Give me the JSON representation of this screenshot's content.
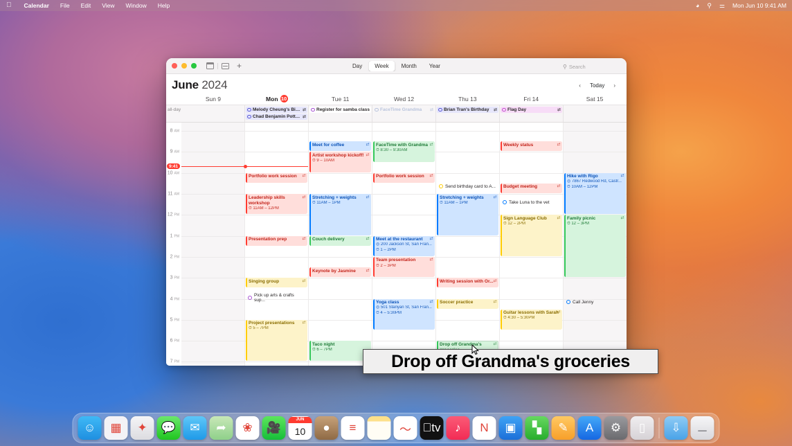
{
  "menubar": {
    "apple_icon": "apple-logo-icon",
    "items": [
      "Calendar",
      "File",
      "Edit",
      "View",
      "Window",
      "Help"
    ],
    "status_icons": [
      "wifi-icon",
      "search-icon",
      "control-center-icon"
    ],
    "clock": "Mon Jun 10  9:41 AM"
  },
  "window": {
    "toolbar": {
      "calendar_view_icon": "calendar-icon",
      "inbox_icon": "inbox-icon",
      "add_label": "+",
      "segments": [
        "Day",
        "Week",
        "Month",
        "Year"
      ],
      "active_segment": "Week",
      "search_placeholder": "Search",
      "search_icon": "magnifier-icon"
    },
    "header": {
      "month": "June",
      "year": "2024",
      "prev_label": "‹",
      "today_label": "Today",
      "next_label": "›"
    },
    "days": [
      {
        "label": "Sun 9",
        "weekday": "Sun",
        "num": "9",
        "today": false,
        "weekend": true
      },
      {
        "label": "Mon 10",
        "weekday": "Mon",
        "num": "10",
        "today": true,
        "weekend": false
      },
      {
        "label": "Tue 11",
        "weekday": "Tue",
        "num": "11",
        "today": false,
        "weekend": false
      },
      {
        "label": "Wed 12",
        "weekday": "Wed",
        "num": "12",
        "today": false,
        "weekend": false
      },
      {
        "label": "Thu 13",
        "weekday": "Thu",
        "num": "13",
        "today": false,
        "weekend": false
      },
      {
        "label": "Fri 14",
        "weekday": "Fri",
        "num": "14",
        "today": false,
        "weekend": false
      },
      {
        "label": "Sat 15",
        "weekday": "Sat",
        "num": "15",
        "today": false,
        "weekend": true
      }
    ],
    "allday_label": "all-day",
    "allday_events": [
      {
        "day": 1,
        "title": "Melody Cheung's Birt...",
        "color": "#5a5ad6",
        "bg": "#e6e6fb",
        "repeat": true
      },
      {
        "day": 1,
        "title": "Chad Benjamin Potter...",
        "color": "#5a5ad6",
        "bg": "#e6e6fb",
        "repeat": true
      },
      {
        "day": 2,
        "title": "Register for samba class",
        "color": "#a74fd3",
        "bg": "#ffffff",
        "repeat": false
      },
      {
        "day": 3,
        "title": "FaceTime Grandma",
        "color": "#b9c4dd",
        "bg": "#f7f5f6",
        "repeat": true,
        "dim": true
      },
      {
        "day": 4,
        "title": "Brian Tran's Birthday",
        "color": "#5a5ad6",
        "bg": "#e6e6fb",
        "repeat": true
      },
      {
        "day": 5,
        "title": "Flag Day",
        "color": "#c44fd0",
        "bg": "#f7dcf7",
        "repeat": true
      }
    ],
    "time_labels": [
      {
        "hour": "8",
        "suffix": "AM"
      },
      {
        "hour": "9",
        "suffix": "AM"
      },
      {
        "hour": "10",
        "suffix": "AM"
      },
      {
        "hour": "11",
        "suffix": "AM"
      },
      {
        "hour": "12",
        "suffix": "PM"
      },
      {
        "hour": "1",
        "suffix": "PM"
      },
      {
        "hour": "2",
        "suffix": "PM"
      },
      {
        "hour": "3",
        "suffix": "PM"
      },
      {
        "hour": "4",
        "suffix": "PM"
      },
      {
        "hour": "5",
        "suffix": "PM"
      },
      {
        "hour": "6",
        "suffix": "PM"
      },
      {
        "hour": "7",
        "suffix": "PM"
      }
    ],
    "now": {
      "badge": "9:41",
      "hour_position": 9.68
    },
    "events": [
      {
        "day": 1,
        "title": "Portfolio work session",
        "start": 10.0,
        "end": 10.5,
        "color": "#ff3b30",
        "bg": "#ffdedb",
        "text": "#c32219",
        "repeat": true
      },
      {
        "day": 1,
        "title": "Leadership skills workshop",
        "time": "11AM – 12PM",
        "start": 11.0,
        "end": 12.0,
        "color": "#ff3b30",
        "bg": "#ffdedb",
        "text": "#c32219",
        "repeat": true,
        "two_line": true,
        "clock": true
      },
      {
        "day": 1,
        "title": "Presentation prep",
        "start": 13.0,
        "end": 13.5,
        "color": "#ff3b30",
        "bg": "#ffdedb",
        "text": "#c32219",
        "repeat": true
      },
      {
        "day": 1,
        "title": "Singing group",
        "start": 15.0,
        "end": 15.5,
        "color": "#ffcc00",
        "bg": "#fdf3c9",
        "text": "#8a6d00",
        "repeat": true
      },
      {
        "day": 1,
        "title": "Project presentations",
        "time": "5 – 7PM",
        "start": 17.0,
        "end": 19.0,
        "color": "#ffcc00",
        "bg": "#fdf3c9",
        "text": "#8a6d00",
        "repeat": true,
        "clock": true
      },
      {
        "day": 2,
        "title": "Meet for coffee",
        "start": 8.5,
        "end": 9.0,
        "color": "#007aff",
        "bg": "#cfe4ff",
        "text": "#0a52b8",
        "repeat": true
      },
      {
        "day": 2,
        "title": "Artist workshop kickoff!",
        "time": "9 – 10AM",
        "start": 9.0,
        "end": 10.0,
        "color": "#ff3b30",
        "bg": "#ffdedb",
        "text": "#c32219",
        "repeat": true,
        "clock": true
      },
      {
        "day": 2,
        "title": "Stretching + weights",
        "time": "11AM – 1PM",
        "start": 11.0,
        "end": 13.0,
        "color": "#007aff",
        "bg": "#cfe4ff",
        "text": "#0a52b8",
        "repeat": true,
        "clock": true
      },
      {
        "day": 2,
        "title": "Couch delivery",
        "start": 13.0,
        "end": 13.5,
        "color": "#34c759",
        "bg": "#d6f4dd",
        "text": "#1d7a36",
        "repeat": true
      },
      {
        "day": 2,
        "title": "Keynote by Jasmine",
        "start": 14.5,
        "end": 15.0,
        "color": "#ff3b30",
        "bg": "#ffdedb",
        "text": "#c32219",
        "repeat": true
      },
      {
        "day": 2,
        "title": "Taco night",
        "time": "6 – 7PM",
        "start": 18.0,
        "end": 19.0,
        "color": "#34c759",
        "bg": "#d6f4dd",
        "text": "#1d7a36",
        "repeat": false,
        "clock": true
      },
      {
        "day": 3,
        "title": "FaceTime with Grandma",
        "time": "8:30 – 9:30AM",
        "start": 8.5,
        "end": 9.5,
        "color": "#34c759",
        "bg": "#d6f4dd",
        "text": "#1d7a36",
        "repeat": true,
        "clock": true
      },
      {
        "day": 3,
        "title": "Portfolio work session",
        "start": 10.0,
        "end": 10.5,
        "color": "#ff3b30",
        "bg": "#ffdedb",
        "text": "#c32219",
        "repeat": true
      },
      {
        "day": 3,
        "title": "Meet at the restaurant",
        "place": "200 Jackson St, San Fran...",
        "time": "1 – 2PM",
        "start": 13.0,
        "end": 14.0,
        "color": "#007aff",
        "bg": "#cfe4ff",
        "text": "#0a52b8",
        "repeat": true,
        "clock": true,
        "pin": true
      },
      {
        "day": 3,
        "title": "Team presentation",
        "time": "2 – 3PM",
        "start": 14.0,
        "end": 15.0,
        "color": "#ff3b30",
        "bg": "#ffdedb",
        "text": "#c32219",
        "repeat": true,
        "clock": true
      },
      {
        "day": 3,
        "title": "Yoga class",
        "place": "501 Stanyan St, San Fran...",
        "time": "4 – 5:30PM",
        "start": 16.0,
        "end": 17.5,
        "color": "#007aff",
        "bg": "#cfe4ff",
        "text": "#0a52b8",
        "repeat": true,
        "clock": true,
        "pin": true
      },
      {
        "day": 4,
        "title": "Stretching + weights",
        "time": "11AM – 1PM",
        "start": 11.0,
        "end": 13.0,
        "color": "#007aff",
        "bg": "#cfe4ff",
        "text": "#0a52b8",
        "repeat": true,
        "clock": true
      },
      {
        "day": 4,
        "title": "Writing session with Or...",
        "start": 15.0,
        "end": 15.5,
        "color": "#ff3b30",
        "bg": "#ffdedb",
        "text": "#c32219",
        "repeat": true
      },
      {
        "day": 4,
        "title": "Soccer practice",
        "start": 16.0,
        "end": 16.5,
        "color": "#ffcc00",
        "bg": "#fdf3c9",
        "text": "#8a6d00",
        "repeat": true
      },
      {
        "day": 4,
        "title": "Drop off Grandma's groceries",
        "start": 18.0,
        "end": 19.0,
        "color": "#34c759",
        "bg": "#d6f4dd",
        "text": "#1d7a36",
        "repeat": true,
        "two_line": true,
        "hovered": true
      },
      {
        "day": 5,
        "title": "Weekly status",
        "start": 8.5,
        "end": 9.0,
        "color": "#ff3b30",
        "bg": "#ffdedb",
        "text": "#c32219",
        "repeat": true
      },
      {
        "day": 5,
        "title": "Budget meeting",
        "start": 10.5,
        "end": 11.0,
        "color": "#ff3b30",
        "bg": "#ffdedb",
        "text": "#c32219",
        "repeat": true
      },
      {
        "day": 5,
        "title": "Sign Language Club",
        "time": "12 – 2PM",
        "start": 12.0,
        "end": 14.0,
        "color": "#ffcc00",
        "bg": "#fdf3c9",
        "text": "#8a6d00",
        "repeat": true,
        "clock": true
      },
      {
        "day": 5,
        "title": "Guitar lessons with Sarah",
        "time": "4:30 – 5:30PM",
        "start": 16.5,
        "end": 17.5,
        "color": "#ffcc00",
        "bg": "#fdf3c9",
        "text": "#8a6d00",
        "repeat": true,
        "two_line": true,
        "clock": true
      },
      {
        "day": 6,
        "title": "Hike with Rigo",
        "place": "7867 Redwood Rd, Castr...",
        "time": "10AM – 12PM",
        "start": 10.0,
        "end": 12.0,
        "color": "#007aff",
        "bg": "#cfe4ff",
        "text": "#0a52b8",
        "repeat": true,
        "clock": true,
        "pin": true
      },
      {
        "day": 6,
        "title": "Family picnic",
        "time": "12 – 3PM",
        "start": 12.0,
        "end": 15.0,
        "color": "#34c759",
        "bg": "#d6f4dd",
        "text": "#1d7a36",
        "repeat": true,
        "clock": true
      }
    ],
    "reminders": [
      {
        "day": 4,
        "title": "Send birthday card to A...",
        "at": 10.5,
        "color": "#ffcc00"
      },
      {
        "day": 5,
        "title": "Take Luna to the vet",
        "at": 11.25,
        "color": "#007aff"
      },
      {
        "day": 1,
        "title": "Pick up arts & crafts sup...",
        "at": 15.7,
        "color": "#a74fd3"
      },
      {
        "day": 6,
        "title": "Call Jenny",
        "at": 16.0,
        "color": "#007aff"
      }
    ]
  },
  "tooltip": {
    "text": "Drop off Grandma's groceries"
  },
  "dock": {
    "apps": [
      {
        "name": "finder",
        "running": true
      },
      {
        "name": "launchpad",
        "running": false
      },
      {
        "name": "safari",
        "running": false
      },
      {
        "name": "messages",
        "running": false
      },
      {
        "name": "mail",
        "running": false
      },
      {
        "name": "maps",
        "running": false
      },
      {
        "name": "photos",
        "running": false
      },
      {
        "name": "facetime",
        "running": false
      },
      {
        "name": "calendar",
        "running": true,
        "month": "JUN",
        "day": "10"
      },
      {
        "name": "contacts",
        "running": false
      },
      {
        "name": "reminders",
        "running": false
      },
      {
        "name": "notes",
        "running": false
      },
      {
        "name": "freeform",
        "running": false
      },
      {
        "name": "appletv",
        "running": false
      },
      {
        "name": "music",
        "running": false
      },
      {
        "name": "news",
        "running": false
      },
      {
        "name": "keynote",
        "running": false
      },
      {
        "name": "numbers",
        "running": false
      },
      {
        "name": "pages",
        "running": false
      },
      {
        "name": "appstore",
        "running": false
      },
      {
        "name": "settings",
        "running": false
      },
      {
        "name": "iphone-mirroring",
        "running": false
      }
    ],
    "downloads_folder": "downloads-folder-icon",
    "trash": "trash-icon"
  }
}
